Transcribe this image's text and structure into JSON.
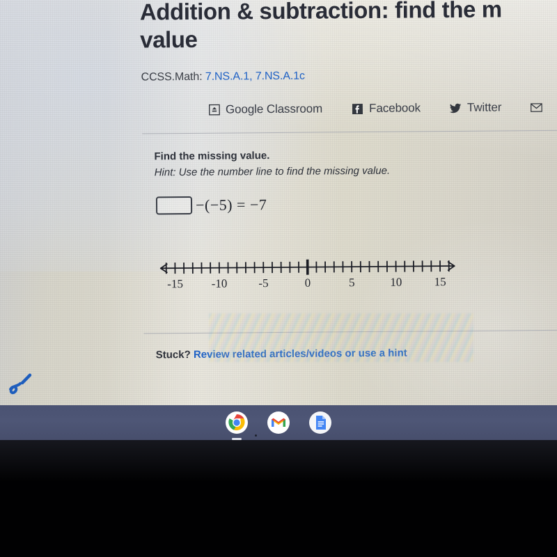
{
  "page": {
    "title": "Addition & subtraction: find the m",
    "title_full_visible": "Addition & subtraction: find the m\nvalue",
    "title_line1": "Addition & subtraction: find the m",
    "title_line2": "value",
    "standards_label": "CCSS.Math:",
    "standards_links": "7.NS.A.1, 7.NS.A.1c"
  },
  "share": {
    "items": [
      {
        "label": "Google Classroom",
        "icon": "google-classroom-icon"
      },
      {
        "label": "Facebook",
        "icon": "facebook-icon"
      },
      {
        "label": "Twitter",
        "icon": "twitter-icon"
      },
      {
        "label": "",
        "icon": "email-envelope-icon"
      }
    ]
  },
  "exercise": {
    "prompt": "Find the missing value.",
    "hint": "Hint: Use the number line to find the missing value.",
    "answer_input_value": "",
    "equation_after_box": "−(−5) = −7",
    "stuck_prefix": "Stuck? ",
    "stuck_link": "Review related articles/videos or use a hint"
  },
  "chart_data": {
    "type": "number-line",
    "title": "",
    "xlabel": "",
    "ylabel": "",
    "xlim": [
      -16,
      16
    ],
    "tick_step": 1,
    "ticks": [
      -16,
      -15,
      -14,
      -13,
      -12,
      -11,
      -10,
      -9,
      -8,
      -7,
      -6,
      -5,
      -4,
      -3,
      -2,
      -1,
      0,
      1,
      2,
      3,
      4,
      5,
      6,
      7,
      8,
      9,
      10,
      11,
      12,
      13,
      14,
      15,
      16
    ],
    "labeled_ticks": [
      -15,
      -10,
      -5,
      0,
      5,
      10,
      15
    ],
    "tick_labels": [
      "-15",
      "-10",
      "-5",
      "0",
      "5",
      "10",
      "15"
    ],
    "emphasized_tick": 0,
    "arrows": [
      "left",
      "right"
    ],
    "grid": false,
    "legend": false,
    "plotted_points": [],
    "line_color": "#1b1d25"
  },
  "taskbar": {
    "apps": [
      {
        "name": "chrome-app",
        "label": "Google Chrome",
        "running": true
      },
      {
        "name": "gmail-app",
        "label": "Gmail",
        "running": false
      },
      {
        "name": "google-docs-app",
        "label": "Google Docs",
        "running": false
      }
    ]
  },
  "annotation": {
    "stylus_mark": "blue handwritten squiggle"
  },
  "colors": {
    "accent_link": "#1f63c9",
    "text": "#2e323b",
    "screen_bg": "#dedbcf",
    "shelf_bg": "#4e5676",
    "bezel_black": "#010102"
  }
}
